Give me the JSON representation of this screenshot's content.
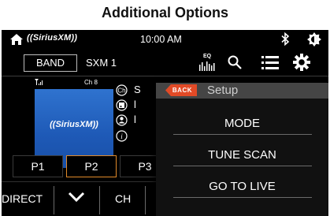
{
  "page": {
    "heading": "Additional Options"
  },
  "status_bar": {
    "brand_logo": "((SiriusXM))",
    "time": "10:00 AM",
    "icons": [
      "home-icon",
      "bluetooth-icon",
      "brightness-icon"
    ]
  },
  "toolbar": {
    "band_label": "BAND",
    "channel_name": "SXM 1",
    "eq_label": "EQ",
    "icons": [
      "equalizer-icon",
      "search-icon",
      "list-icon",
      "settings-icon"
    ]
  },
  "now_playing": {
    "channel_number": "Ch 8",
    "album_logo": "((SiriusXM))",
    "info_rows": [
      {
        "icon": "channel-icon",
        "text": "S"
      },
      {
        "icon": "song-icon",
        "text": "l"
      },
      {
        "icon": "artist-icon",
        "text": "l"
      },
      {
        "icon": "info-icon",
        "text": ""
      }
    ]
  },
  "presets": {
    "items": [
      "P1",
      "P2",
      "P3"
    ],
    "selected": "P2"
  },
  "bottom_bar": {
    "direct_label": "DIRECT",
    "ch_label": "CH"
  },
  "setup_menu": {
    "back_label": "BACK",
    "title": "Setup",
    "items": [
      "MODE",
      "TUNE SCAN",
      "GO TO LIVE"
    ]
  },
  "colors": {
    "accent": "#e08a2a",
    "back_button": "#e24a26",
    "brand_blue": "#2d6ad8",
    "screen_background": "#000000"
  }
}
